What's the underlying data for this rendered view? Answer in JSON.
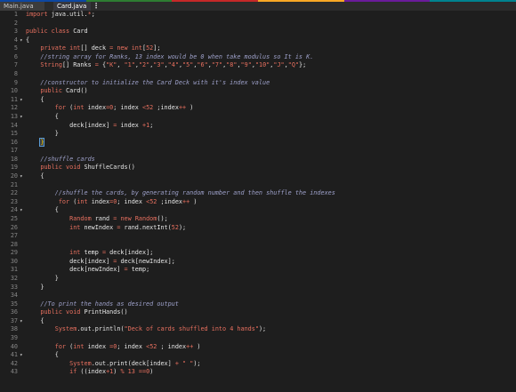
{
  "topstrip": {
    "colors": [
      "#0d47a1",
      "#2e7d32",
      "#c62828",
      "#f9a825",
      "#6a1b9a",
      "#00838f"
    ]
  },
  "tabs": [
    {
      "label": "Main.java",
      "active": false
    },
    {
      "label": "Card.java",
      "active": true
    }
  ],
  "tab_menu_icon": "⋮",
  "lines": [
    {
      "n": "1",
      "fold": "",
      "code": "import java.util.*;"
    },
    {
      "n": "2",
      "fold": "",
      "code": ""
    },
    {
      "n": "3",
      "fold": "",
      "code": "public class Card"
    },
    {
      "n": "4",
      "fold": "▾",
      "code": "{"
    },
    {
      "n": "5",
      "fold": "",
      "code": "    private int[] deck = new int[52];"
    },
    {
      "n": "6",
      "fold": "",
      "code": "    //string array for Ranks, 13 index would be 0 when take modulus so It is K."
    },
    {
      "n": "7",
      "fold": "",
      "code": "    String[] Ranks = {\"K\", \"1\",\"2\",\"3\",\"4\",\"5\",\"6\",\"7\",\"8\",\"9\",\"10\",\"J\",\"Q\"};"
    },
    {
      "n": "8",
      "fold": "",
      "code": ""
    },
    {
      "n": "9",
      "fold": "",
      "code": "    //constructor to initialize the Card Deck with it's index value"
    },
    {
      "n": "10",
      "fold": "",
      "code": "    public Card()"
    },
    {
      "n": "11",
      "fold": "▾",
      "code": "    {"
    },
    {
      "n": "12",
      "fold": "",
      "code": "        for (int index=0; index <52 ;index++ )"
    },
    {
      "n": "13",
      "fold": "▾",
      "code": "        {"
    },
    {
      "n": "14",
      "fold": "",
      "code": "            deck[index] = index +1;"
    },
    {
      "n": "15",
      "fold": "",
      "code": "        }"
    },
    {
      "n": "16",
      "fold": "",
      "code": "    }"
    },
    {
      "n": "17",
      "fold": "",
      "code": ""
    },
    {
      "n": "18",
      "fold": "",
      "code": "    //shuffle cards"
    },
    {
      "n": "19",
      "fold": "",
      "code": "    public void ShuffleCards()"
    },
    {
      "n": "20",
      "fold": "▾",
      "code": "    {"
    },
    {
      "n": "21",
      "fold": "",
      "code": ""
    },
    {
      "n": "22",
      "fold": "",
      "code": "        //shuffle the cards, by generating random number and then shuffle the indexes"
    },
    {
      "n": "23",
      "fold": "",
      "code": "         for (int index=0; index <52 ;index++ )"
    },
    {
      "n": "24",
      "fold": "▾",
      "code": "        {"
    },
    {
      "n": "25",
      "fold": "",
      "code": "            Random rand = new Random();"
    },
    {
      "n": "26",
      "fold": "",
      "code": "            int newIndex = rand.nextInt(52);"
    },
    {
      "n": "27",
      "fold": "",
      "code": ""
    },
    {
      "n": "28",
      "fold": "",
      "code": ""
    },
    {
      "n": "29",
      "fold": "",
      "code": "            int temp = deck[index];"
    },
    {
      "n": "30",
      "fold": "",
      "code": "            deck[index] = deck[newIndex];"
    },
    {
      "n": "31",
      "fold": "",
      "code": "            deck[newIndex] = temp;"
    },
    {
      "n": "32",
      "fold": "",
      "code": "        }"
    },
    {
      "n": "33",
      "fold": "",
      "code": "    }"
    },
    {
      "n": "34",
      "fold": "",
      "code": ""
    },
    {
      "n": "35",
      "fold": "",
      "code": "    //To print the hands as desired output"
    },
    {
      "n": "36",
      "fold": "",
      "code": "    public void PrintHands()"
    },
    {
      "n": "37",
      "fold": "▾",
      "code": "    {"
    },
    {
      "n": "38",
      "fold": "",
      "code": "        System.out.println(\"Deck of cards shuffled into 4 hands\");"
    },
    {
      "n": "39",
      "fold": "",
      "code": ""
    },
    {
      "n": "40",
      "fold": "",
      "code": "        for (int index =0; index <52 ; index++ )"
    },
    {
      "n": "41",
      "fold": "▾",
      "code": "        {"
    },
    {
      "n": "42",
      "fold": "",
      "code": "            System.out.print(deck[index] + \" \");"
    },
    {
      "n": "43",
      "fold": "",
      "code": "            if ((index+1) % 13 ==0)"
    }
  ]
}
